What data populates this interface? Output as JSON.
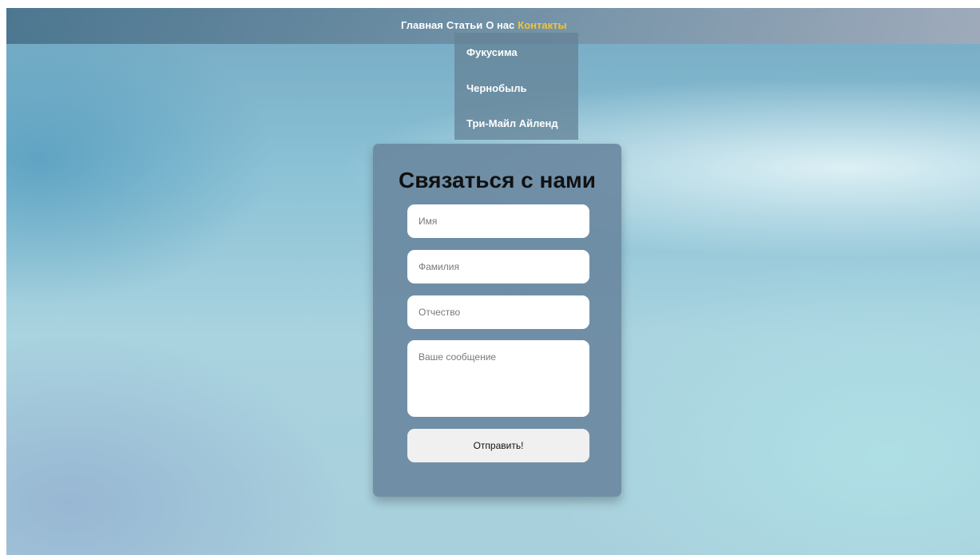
{
  "nav": {
    "items": [
      {
        "label": "Главная"
      },
      {
        "label": "Статьи"
      },
      {
        "label": "О нас"
      },
      {
        "label": "Контакты"
      }
    ],
    "active_color": "#f4c430",
    "text_color": "#ffffff"
  },
  "dropdown": {
    "items": [
      {
        "label": "Фукусима"
      },
      {
        "label": "Чернобыль"
      },
      {
        "label": "Три-Майл Айленд"
      }
    ]
  },
  "contact_form": {
    "title": "Связаться с нами",
    "first_name_placeholder": "Имя",
    "last_name_placeholder": "Фамилия",
    "patronymic_placeholder": "Отчество",
    "message_placeholder": "Ваше сообщение",
    "submit_label": "Отправить!"
  }
}
